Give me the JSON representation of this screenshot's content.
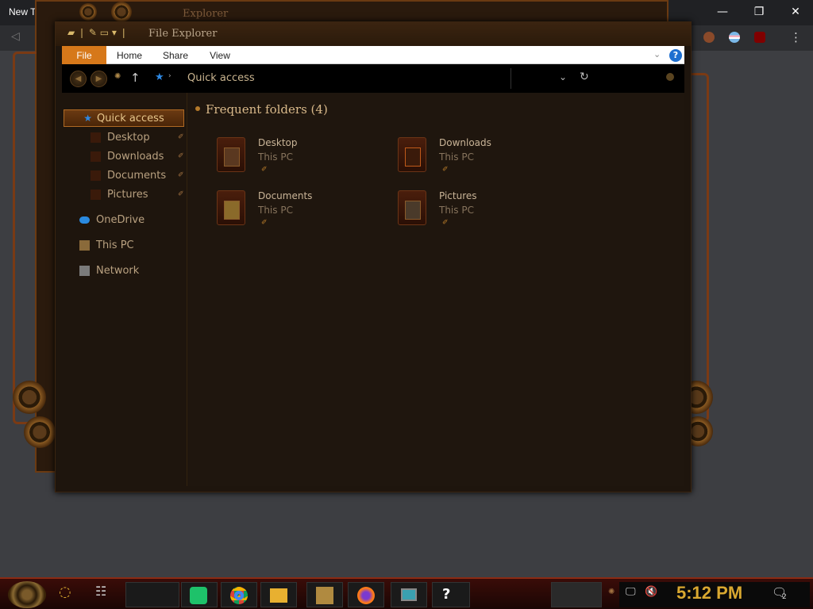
{
  "browser": {
    "tab_title": "New T",
    "minimize": "—",
    "restore": "❐",
    "close": "✕",
    "back": "◁",
    "menu": "⋮"
  },
  "bg_window": {
    "title": "Explorer"
  },
  "explorer": {
    "title": "File Explorer",
    "ribbon_tabs": [
      "File",
      "Home",
      "Share",
      "View"
    ],
    "help": "?",
    "address": "Quick access",
    "sidebar": [
      {
        "label": "Quick access",
        "icon": "star-icon",
        "selected": true
      },
      {
        "label": "Desktop",
        "icon": "desktop-folder-icon"
      },
      {
        "label": "Downloads",
        "icon": "downloads-folder-icon"
      },
      {
        "label": "Documents",
        "icon": "documents-folder-icon"
      },
      {
        "label": "Pictures",
        "icon": "pictures-folder-icon"
      },
      {
        "label": "OneDrive",
        "icon": "cloud-icon"
      },
      {
        "label": "This PC",
        "icon": "computer-icon"
      },
      {
        "label": "Network",
        "icon": "network-icon"
      }
    ],
    "group_title": "Frequent folders (4)",
    "folders": [
      {
        "name": "Desktop",
        "location": "This PC"
      },
      {
        "name": "Downloads",
        "location": "This PC"
      },
      {
        "name": "Documents",
        "location": "This PC"
      },
      {
        "name": "Pictures",
        "location": "This PC"
      }
    ]
  },
  "taskbar": {
    "clock": "5:12 PM",
    "notifications": "2"
  },
  "colors": {
    "accent": "#d6781a",
    "clock": "#d9a830",
    "frame": "#7a3a14"
  }
}
